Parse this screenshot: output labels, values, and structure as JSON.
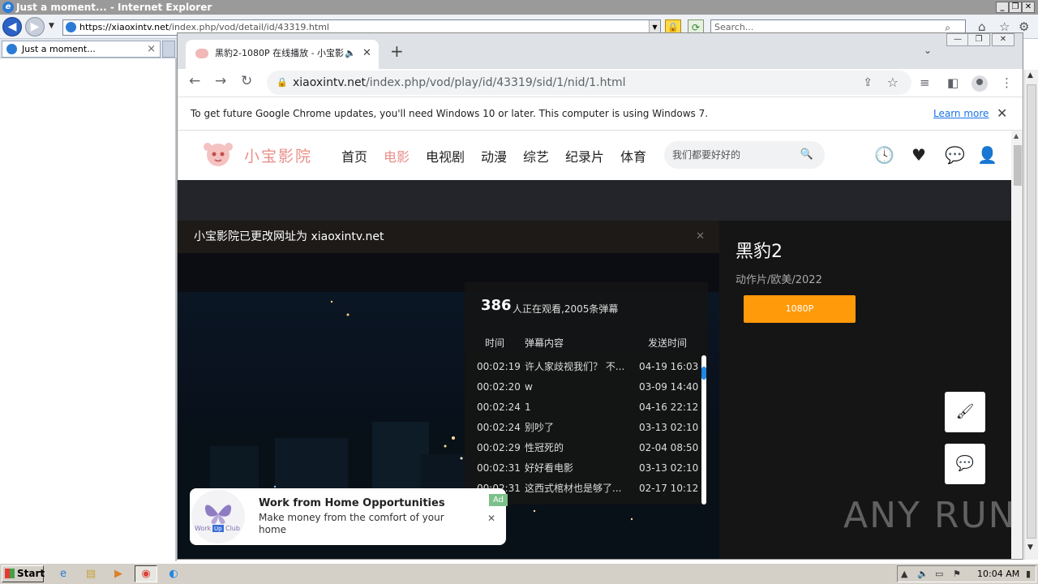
{
  "ie": {
    "title": "Just a moment... - Internet Explorer",
    "address_domain": "https://xiaoxintv.net",
    "address_path": "/index.php/vod/detail/id/43319.html",
    "search_placeholder": "Search...",
    "tab_label": "Just a moment..."
  },
  "chrome": {
    "tab_title": "黑豹2-1080P 在线播放 - 小宝影",
    "url_host": "xiaoxintv.net",
    "url_path": "/index.php/vod/play/id/43319/sid/1/nid/1.html",
    "infobar_text": "To get future Google Chrome updates, you'll need Windows 10 or later. This computer is using Windows 7.",
    "infobar_link": "Learn more"
  },
  "site": {
    "logo_text": "小宝影院",
    "nav": [
      "首页",
      "电影",
      "电视剧",
      "动漫",
      "综艺",
      "纪录片",
      "体育"
    ],
    "active_nav": "电影",
    "search_placeholder": "我们都要好好的",
    "notice": "小宝影院已更改网址为 xiaoxintv.net"
  },
  "danmaku": {
    "count": "386",
    "count_text": "人正在观看,2005条弹幕",
    "headers": {
      "time": "时间",
      "content": "弹幕内容",
      "sent": "发送时间"
    },
    "rows": [
      {
        "time": "00:02:19",
        "content": "许人家歧视我们？ 不...",
        "sent": "04-19 16:03"
      },
      {
        "time": "00:02:20",
        "content": "w",
        "sent": "03-09 14:40"
      },
      {
        "time": "00:02:24",
        "content": "1",
        "sent": "04-16 22:12"
      },
      {
        "time": "00:02:24",
        "content": "别吵了",
        "sent": "03-13 02:10"
      },
      {
        "time": "00:02:29",
        "content": "性冠死的",
        "sent": "02-04 08:50"
      },
      {
        "time": "00:02:31",
        "content": "好好看电影",
        "sent": "03-13 02:10"
      },
      {
        "time": "00:02:31",
        "content": "这西式棺材也是够了...",
        "sent": "02-17 10:12"
      }
    ],
    "scroll_position": 0.05
  },
  "ad": {
    "title": "Work from Home Opportunities",
    "description": "Make money from the comfort of your home",
    "badge": "Ad",
    "logo_text_1": "Work",
    "logo_text_2": "Up",
    "logo_text_3": "Club"
  },
  "movie": {
    "title": "黑豹2",
    "meta": "动作片/欧美/2022",
    "source_button": "1080P"
  },
  "taskbar": {
    "start": "Start",
    "clock": "10:04 AM"
  },
  "watermark": "ANY RUN",
  "colors": {
    "accent_pink": "#e88f8a",
    "source_orange": "#ff9a0a",
    "ad_badge_green": "#7cc08a",
    "chrome_link_blue": "#1a73e8"
  }
}
